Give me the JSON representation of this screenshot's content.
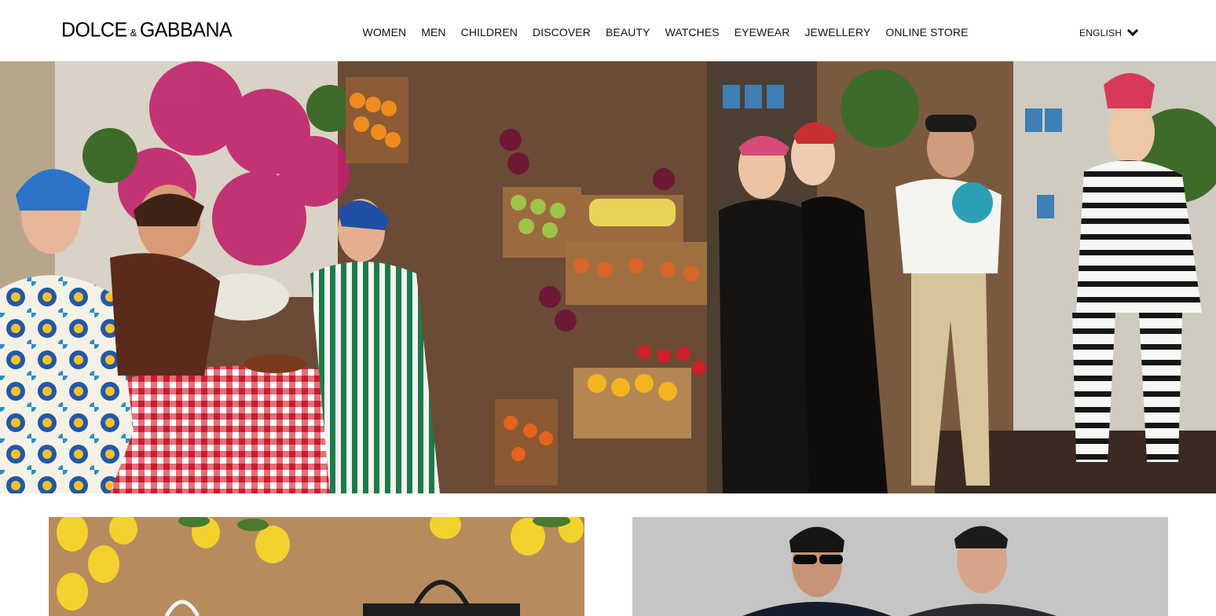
{
  "header": {
    "logo": {
      "word1": "DOLCE",
      "amp": "&",
      "word2": "GABBANA"
    },
    "nav": [
      "WOMEN",
      "MEN",
      "CHILDREN",
      "DISCOVER",
      "BEAUTY",
      "WATCHES",
      "EYEWEAR",
      "JEWELLERY",
      "ONLINE STORE"
    ],
    "language": {
      "label": "ENGLISH",
      "icon": "chevron-down-icon"
    }
  },
  "hero": {
    "image": "campaign-photo-market-scene"
  },
  "promos": [
    {
      "image": "lemons-handbags-photo"
    },
    {
      "image": "menswear-models-photo"
    }
  ],
  "colors": {
    "text": "#111111",
    "background": "#ffffff",
    "gingham": "#d8283a",
    "lemon": "#f3d22e"
  }
}
